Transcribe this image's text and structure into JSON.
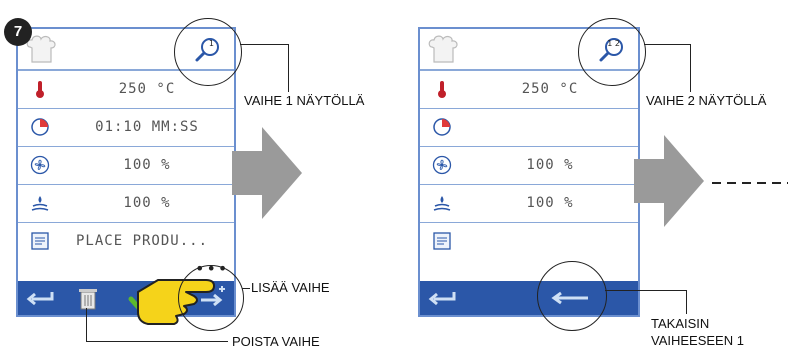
{
  "step_badge": "7",
  "screen1": {
    "search_badge": "1",
    "rows": [
      {
        "icon": "thermometer-icon",
        "value": "250 °C"
      },
      {
        "icon": "timer-icon",
        "value": "01:10 MM:SS"
      },
      {
        "icon": "fan-icon",
        "value": "100 %"
      },
      {
        "icon": "humidity-icon",
        "value": "100 %"
      },
      {
        "icon": "info-icon",
        "value": "PLACE PRODU..."
      }
    ]
  },
  "screen2": {
    "search_badge": "1 2",
    "rows": [
      {
        "icon": "thermometer-icon",
        "value": "250 °C"
      },
      {
        "icon": "timer-icon",
        "value": ""
      },
      {
        "icon": "fan-icon",
        "value": "100 %"
      },
      {
        "icon": "humidity-icon",
        "value": "100 %"
      },
      {
        "icon": "info-icon",
        "value": ""
      }
    ]
  },
  "callouts": {
    "step1": "VAIHE 1 NÄYTÖLLÄ",
    "step2": "VAIHE 2 NÄYTÖLLÄ",
    "add_step": "LISÄÄ VAIHE",
    "delete_step": "POISTA VAIHE",
    "back_line1": "TAKAISIN",
    "back_line2": "VAIHEESEEN 1"
  },
  "colors": {
    "accent": "#2b57a8",
    "divider": "#8aa8d8",
    "check": "#5cb82c",
    "hand": "#f5d31a"
  }
}
